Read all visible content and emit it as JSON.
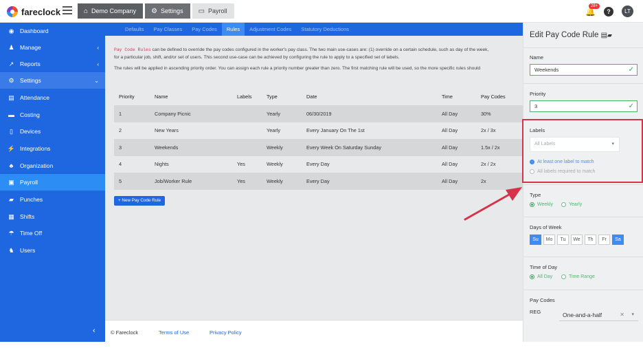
{
  "app": {
    "name": "fareclock"
  },
  "breadcrumb": [
    "Demo Company",
    "Settings",
    "Payroll"
  ],
  "topbar": {
    "notifications": "28+",
    "help": "?",
    "user_initials": "LT"
  },
  "sidebar": {
    "items": [
      {
        "label": "Dashboard",
        "icon": "dashboard-icon"
      },
      {
        "label": "Manage",
        "icon": "user-icon",
        "chevron": "‹"
      },
      {
        "label": "Reports",
        "icon": "chart-icon",
        "chevron": "‹"
      },
      {
        "label": "Settings",
        "icon": "gear-icon",
        "chevron": "⌄"
      },
      {
        "label": "Attendance",
        "icon": "attendance-icon"
      },
      {
        "label": "Costing",
        "icon": "folder-icon"
      },
      {
        "label": "Devices",
        "icon": "device-icon"
      },
      {
        "label": "Integrations",
        "icon": "plug-icon"
      },
      {
        "label": "Organization",
        "icon": "org-icon"
      },
      {
        "label": "Payroll",
        "icon": "money-icon"
      },
      {
        "label": "Punches",
        "icon": "car-icon"
      },
      {
        "label": "Shifts",
        "icon": "calendar-icon"
      },
      {
        "label": "Time Off",
        "icon": "umbrella-icon"
      },
      {
        "label": "Users",
        "icon": "users-icon"
      }
    ],
    "collapse": "‹"
  },
  "tabs": [
    "Defaults",
    "Pay Classes",
    "Pay Codes",
    "Rules",
    "Adjustment Codes",
    "Statutory Deductions"
  ],
  "active_tab": "Rules",
  "intro": {
    "code": "Pay Code Rules",
    "line1": " can be defined to override the pay codes configured in the worker's pay class. The two main use-cases are: (1) override on a certain schedule, such as day of the week,",
    "line2": "for a particular job, shift, and/or set of users. This second use-case can be achieved by configuring the rule to apply to a specified set of labels.",
    "line3": "The rules will be applied in ascending priority order. You can assign each rule a priority number greater than zero. The first matching rule will be used, so the more specific rules should"
  },
  "table": {
    "headers": [
      "Priority",
      "Name",
      "Labels",
      "Type",
      "Date",
      "Time",
      "Pay Codes"
    ],
    "rows": [
      [
        "1",
        "Company Picnic",
        "",
        "Yearly",
        "06/30/2019",
        "All Day",
        "30%"
      ],
      [
        "2",
        "New Years",
        "",
        "Yearly",
        "Every January On The 1st",
        "All Day",
        "2x / 3x"
      ],
      [
        "3",
        "Weekends",
        "",
        "Weekly",
        "Every Week On Saturday Sunday",
        "All Day",
        "1.5x / 2x"
      ],
      [
        "4",
        "Nights",
        "Yes",
        "Weekly",
        "Every Day",
        "All Day",
        "2x / 2x"
      ],
      [
        "5",
        "Job/Worker Rule",
        "Yes",
        "Weekly",
        "Every Day",
        "All Day",
        "2x"
      ]
    ]
  },
  "add_button": "+ New Pay Code Rule",
  "footer": {
    "copyright": "© Fareclock",
    "terms": "Terms of Use",
    "privacy": "Privacy Policy"
  },
  "panel": {
    "title": "Edit Pay Code Rule",
    "name_label": "Name",
    "name_value": "Weekends",
    "priority_label": "Priority",
    "priority_value": "3",
    "labels_label": "Labels",
    "labels_placeholder": "All Labels",
    "match_any": "At least one label to match",
    "match_all": "All labels required to match",
    "type_label": "Type",
    "type_weekly": "Weekly",
    "type_yearly": "Yearly",
    "days_label": "Days of Week",
    "days": [
      "Su",
      "Mo",
      "Tu",
      "We",
      "Th",
      "Fr",
      "Sa"
    ],
    "days_selected": [
      "Su",
      "Sa"
    ],
    "time_label": "Time of Day",
    "time_all": "All Day",
    "time_range": "Time Range",
    "paycodes_label": "Pay Codes",
    "reg_label": "REG",
    "reg_value": "One-and-a-half"
  },
  "colors": {
    "sidebar": "#1f67e0",
    "accent": "#3d8cf3",
    "highlight": "#d6334a"
  }
}
